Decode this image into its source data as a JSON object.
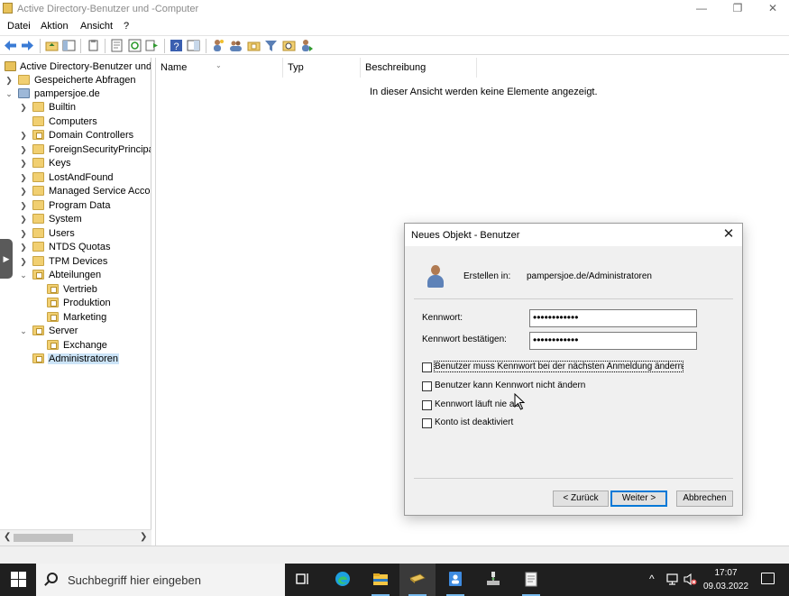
{
  "window": {
    "title": "Active Directory-Benutzer und -Computer",
    "controls": {
      "minimize": "—",
      "restore": "❐",
      "close": "✕"
    }
  },
  "menu": {
    "items": [
      "Datei",
      "Aktion",
      "Ansicht",
      "?"
    ]
  },
  "toolbar": {
    "icons": [
      "back-arrow-icon",
      "forward-arrow-icon",
      "up-folder-icon",
      "console-tree-icon",
      "copy-icon",
      "properties-icon",
      "refresh-icon",
      "export-list-icon",
      "help-icon",
      "show-pane-icon",
      "new-user-icon",
      "new-group-icon",
      "new-ou-icon",
      "filter-icon",
      "find-icon",
      "delegate-icon"
    ]
  },
  "tree": {
    "root": "Active Directory-Benutzer und -",
    "saved_queries": "Gespeicherte Abfragen",
    "domain": "pampersjoe.de",
    "containers": [
      "Builtin",
      "Computers",
      "Domain Controllers",
      "ForeignSecurityPrincipals",
      "Keys",
      "LostAndFound",
      "Managed Service Accounts",
      "Program Data",
      "System",
      "Users",
      "NTDS Quotas",
      "TPM Devices"
    ],
    "abteilungen": {
      "label": "Abteilungen",
      "children": [
        "Vertrieb",
        "Produktion",
        "Marketing"
      ]
    },
    "server": {
      "label": "Server",
      "children": [
        "Exchange"
      ]
    },
    "selected": "Administratoren"
  },
  "list": {
    "columns": [
      "Name",
      "Typ",
      "Beschreibung"
    ],
    "empty_message": "In dieser Ansicht werden keine Elemente angezeigt."
  },
  "dialog": {
    "title": "Neues Objekt - Benutzer",
    "create_in_label": "Erstellen in:",
    "create_in_value": "pampersjoe.de/Administratoren",
    "password_label": "Kennwort:",
    "password_value": "••••••••••••",
    "confirm_label": "Kennwort bestätigen:",
    "confirm_value": "••••••••••••",
    "checkboxes": [
      "Benutzer muss Kennwort bei der nächsten Anmeldung ändern",
      "Benutzer kann Kennwort nicht ändern",
      "Kennwort läuft nie ab",
      "Konto ist deaktiviert"
    ],
    "buttons": {
      "back": "< Zurück",
      "next": "Weiter >",
      "cancel": "Abbrechen"
    }
  },
  "taskbar": {
    "search_placeholder": "Suchbegriff hier eingeben",
    "apps": [
      "task-view-icon",
      "edge-icon",
      "file-explorer-icon",
      "ad-users-computers-icon",
      "user-card-icon",
      "network-tool-icon",
      "notepad-icon"
    ],
    "tray": {
      "chevron": "^"
    },
    "time": "17:07",
    "date": "09.03.2022"
  },
  "colors": {
    "accent": "#0078d7",
    "selection": "#cce4f7",
    "folder": "#f1cf71",
    "taskbar": "#1f1f1f"
  }
}
